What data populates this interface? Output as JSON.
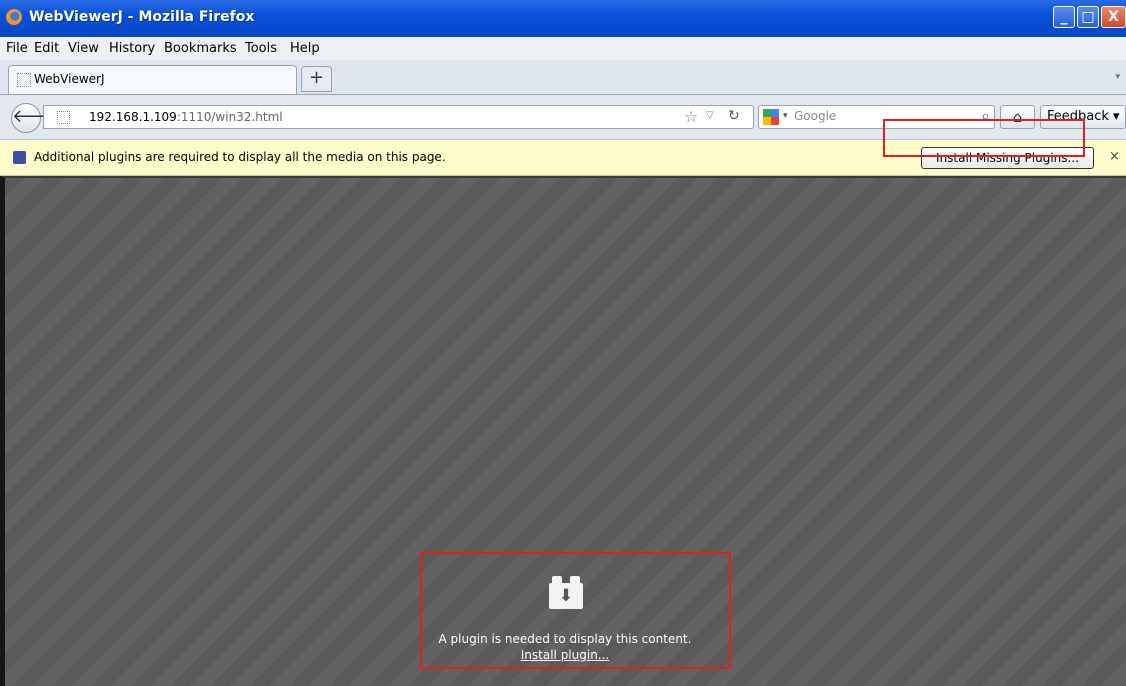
{
  "window": {
    "title": "WebViewerJ - Mozilla Firefox"
  },
  "menu": {
    "items": [
      "File",
      "Edit",
      "View",
      "History",
      "Bookmarks",
      "Tools",
      "Help"
    ]
  },
  "tab": {
    "label": "WebViewerJ",
    "new_tab": "+",
    "scroll": "▾"
  },
  "nav": {
    "url_host": "192.168.1.109",
    "url_path": ":1110/win32.html",
    "search_placeholder": "Google",
    "feedback_label": "Feedback ▾"
  },
  "notification": {
    "message": "Additional plugins are required to display all the media on this page.",
    "install_button": "Install Missing Plugins...",
    "close": "×"
  },
  "plugin": {
    "message": "A plugin is needed to display this content.",
    "install_link": "Install plugin..."
  },
  "icons": {
    "firefox": "firefox-icon",
    "back": "back-arrow-icon",
    "star": "bookmark-star-icon",
    "reload": "reload-icon",
    "search": "magnifier-icon",
    "home": "home-icon",
    "puzzle": "puzzle-icon",
    "plugin": "plugin-download-icon"
  },
  "colors": {
    "titlebar": "#0a50d8",
    "notification": "#fffccc",
    "highlight": "#e0201c",
    "content": "#5e5e5e"
  }
}
